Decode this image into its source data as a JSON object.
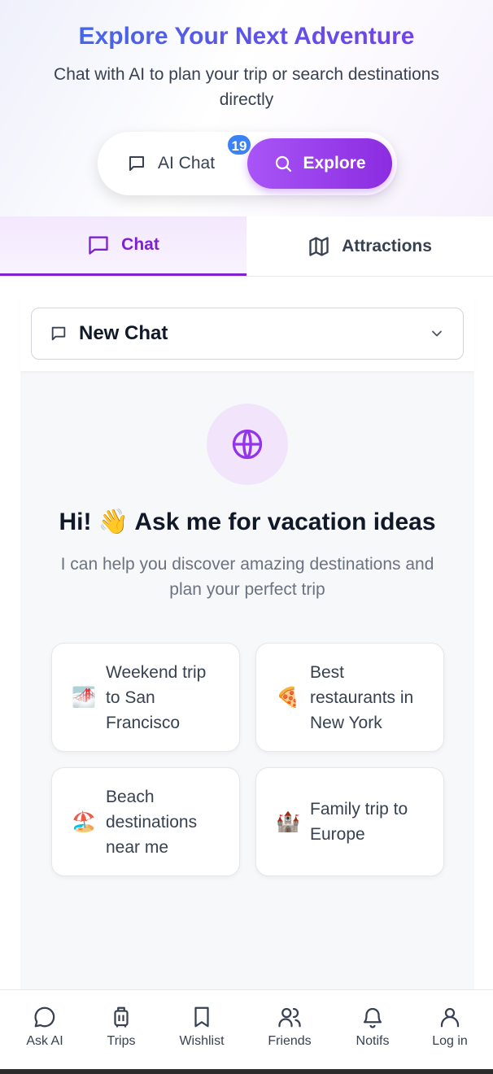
{
  "hero": {
    "title": "Explore Your Next Adventure",
    "subtitle": "Chat with AI to plan your trip or search destinations directly"
  },
  "mode_toggle": {
    "ai_chat_label": "AI Chat",
    "badge_count": "19",
    "explore_label": "Explore"
  },
  "tabs": [
    {
      "label": "Chat",
      "icon": "message-square-icon",
      "active": true
    },
    {
      "label": "Attractions",
      "icon": "map-icon",
      "active": false
    }
  ],
  "chat_selector": {
    "value": "New Chat"
  },
  "welcome": {
    "icon": "globe-icon",
    "title": "Hi! 👋 Ask me for vacation ideas",
    "subtitle": "I can help you discover amazing destinations and plan your perfect trip"
  },
  "suggestions": [
    {
      "emoji": "🌁",
      "text": "Weekend trip to San Francisco"
    },
    {
      "emoji": "🍕",
      "text": "Best restaurants in New York"
    },
    {
      "emoji": "🏖️",
      "text": "Beach destinations near me"
    },
    {
      "emoji": "🏰",
      "text": "Family trip to Europe"
    }
  ],
  "bottom_nav": [
    {
      "label": "Ask AI",
      "icon": "chat-bubble-icon"
    },
    {
      "label": "Trips",
      "icon": "luggage-icon"
    },
    {
      "label": "Wishlist",
      "icon": "bookmark-icon"
    },
    {
      "label": "Friends",
      "icon": "users-icon"
    },
    {
      "label": "Notifs",
      "icon": "bell-icon"
    },
    {
      "label": "Log in",
      "icon": "user-icon"
    }
  ],
  "colors": {
    "accent_purple": "#7e22ce",
    "accent_blue": "#3b82f6"
  }
}
